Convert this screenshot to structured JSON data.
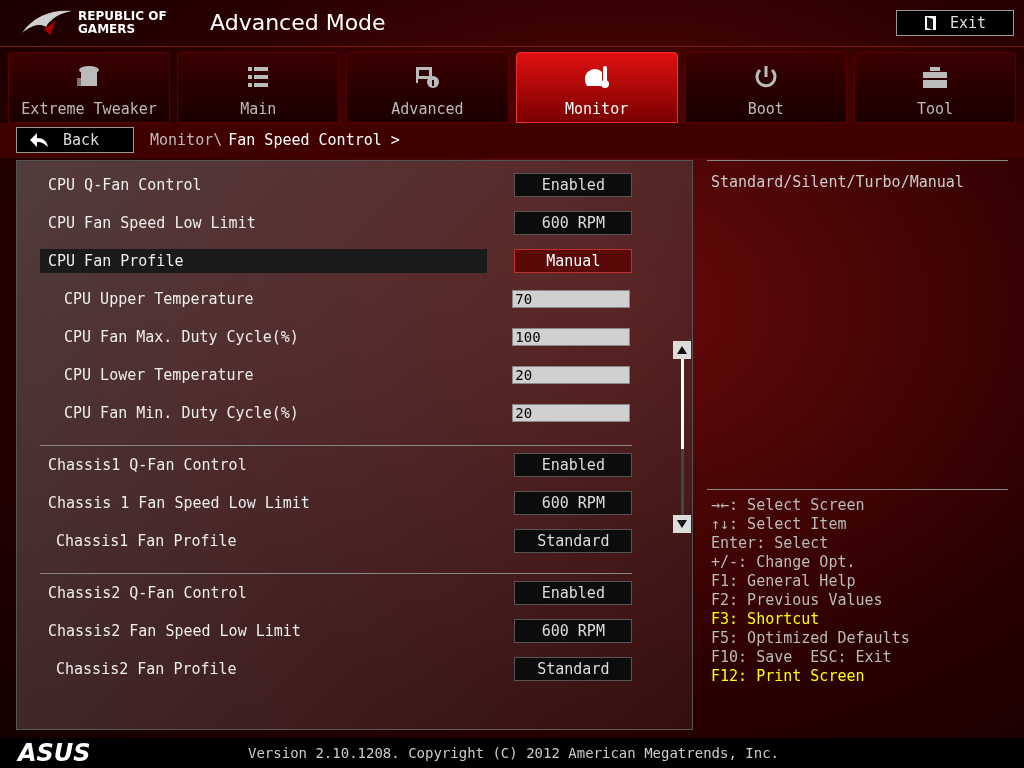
{
  "header": {
    "brand": "REPUBLIC OF\nGAMERS",
    "title": "Advanced Mode",
    "exit_button": "Exit"
  },
  "tabs": [
    {
      "label": "Extreme Tweaker",
      "kind": "tweaker",
      "selected": false
    },
    {
      "label": "Main",
      "kind": "list",
      "selected": false
    },
    {
      "label": "Advanced",
      "kind": "info",
      "selected": false
    },
    {
      "label": "Monitor",
      "kind": "gauge",
      "selected": true
    },
    {
      "label": "Boot",
      "kind": "power",
      "selected": false
    },
    {
      "label": "Tool",
      "kind": "toolbox",
      "selected": false
    }
  ],
  "breadcrumb": {
    "back_button": "Back",
    "path": "Monitor\\",
    "current": "Fan Speed Control >"
  },
  "settings_groups": [
    {
      "rows": [
        {
          "label": "CPU Q-Fan Control",
          "value": "Enabled",
          "kind": "select",
          "selected": false
        },
        {
          "label": "CPU Fan Speed Low Limit",
          "value": "600 RPM",
          "kind": "select",
          "selected": false
        },
        {
          "label": "CPU Fan Profile",
          "value": "Manual",
          "kind": "profile",
          "selected": true,
          "children": [
            {
              "label": "CPU Upper Temperature",
              "value": "70",
              "kind": "input",
              "selected": false
            },
            {
              "label": "CPU Fan Max. Duty Cycle(%)",
              "value": "100",
              "kind": "input",
              "selected": false
            },
            {
              "label": "CPU Lower Temperature",
              "value": "20",
              "kind": "input",
              "selected": false
            },
            {
              "label": "CPU Fan Min. Duty Cycle(%)",
              "value": "20",
              "kind": "input",
              "selected": false
            }
          ]
        }
      ]
    },
    {
      "rows": [
        {
          "label": "Chassis1 Q-Fan Control",
          "value": "Enabled",
          "kind": "select",
          "selected": false
        },
        {
          "label": "Chassis 1 Fan Speed Low Limit",
          "value": "600 RPM",
          "kind": "select",
          "selected": false
        },
        {
          "label": "Chassis1 Fan Profile",
          "value": "Standard",
          "kind": "profile",
          "selected": false
        }
      ]
    },
    {
      "rows": [
        {
          "label": "Chassis2 Q-Fan Control",
          "value": "Enabled",
          "kind": "select",
          "selected": false
        },
        {
          "label": "Chassis2 Fan Speed Low Limit",
          "value": "600 RPM",
          "kind": "select",
          "selected": false
        },
        {
          "label": "Chassis2 Fan Profile",
          "value": "Standard",
          "kind": "profile",
          "selected": false
        }
      ]
    }
  ],
  "help_text": "Standard/Silent/Turbo/Manual",
  "key_help": [
    {
      "text": "→←: Select Screen",
      "highlight": false
    },
    {
      "text": "↑↓: Select Item",
      "highlight": false
    },
    {
      "text": "Enter: Select",
      "highlight": false
    },
    {
      "text": "+/-: Change Opt.",
      "highlight": false
    },
    {
      "text": "F1: General Help",
      "highlight": false
    },
    {
      "text": "F2: Previous Values",
      "highlight": false
    },
    {
      "text": "F3: Shortcut",
      "highlight": true
    },
    {
      "text": "F5: Optimized Defaults",
      "highlight": false
    },
    {
      "text": "F10: Save  ESC: Exit",
      "highlight": false
    },
    {
      "text": "F12: Print Screen",
      "highlight": true
    }
  ],
  "footer": {
    "logo": "ASUS",
    "version": "Version 2.10.1208. Copyright (C) 2012 American Megatrends, Inc."
  }
}
